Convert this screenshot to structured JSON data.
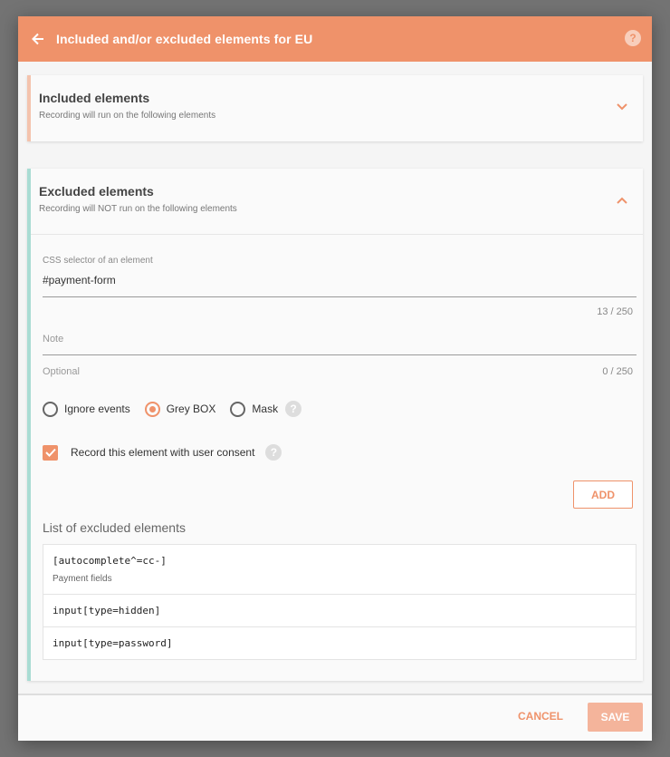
{
  "header": {
    "title": "Included and/or excluded elements for EU",
    "help": "?"
  },
  "included": {
    "title": "Included elements",
    "subtitle": "Recording will run on the following elements"
  },
  "excluded": {
    "title": "Excluded elements",
    "subtitle": "Recording will NOT run on the following elements",
    "css_field": {
      "label": "CSS selector of an element",
      "value": "#payment-form",
      "counter": "13 / 250"
    },
    "note_field": {
      "placeholder": "Note",
      "hint": "Optional",
      "counter": "0 / 250"
    },
    "radios": [
      {
        "label": "Ignore events",
        "checked": false
      },
      {
        "label": "Grey BOX",
        "checked": true
      },
      {
        "label": "Mask",
        "checked": false
      }
    ],
    "consent": {
      "label": "Record this element with user consent",
      "checked": true
    },
    "add_label": "ADD",
    "list_title": "List of excluded elements",
    "list": [
      {
        "selector": "[autocomplete^=cc-]",
        "note": "Payment fields"
      },
      {
        "selector": "input[type=hidden]",
        "note": ""
      },
      {
        "selector": "input[type=password]",
        "note": ""
      }
    ]
  },
  "footer": {
    "cancel_label": "CANCEL",
    "save_label": "SAVE"
  },
  "colors": {
    "accent": "#ef926a",
    "included_bar": "#f4c3ad",
    "excluded_bar": "#a9dcd3"
  }
}
